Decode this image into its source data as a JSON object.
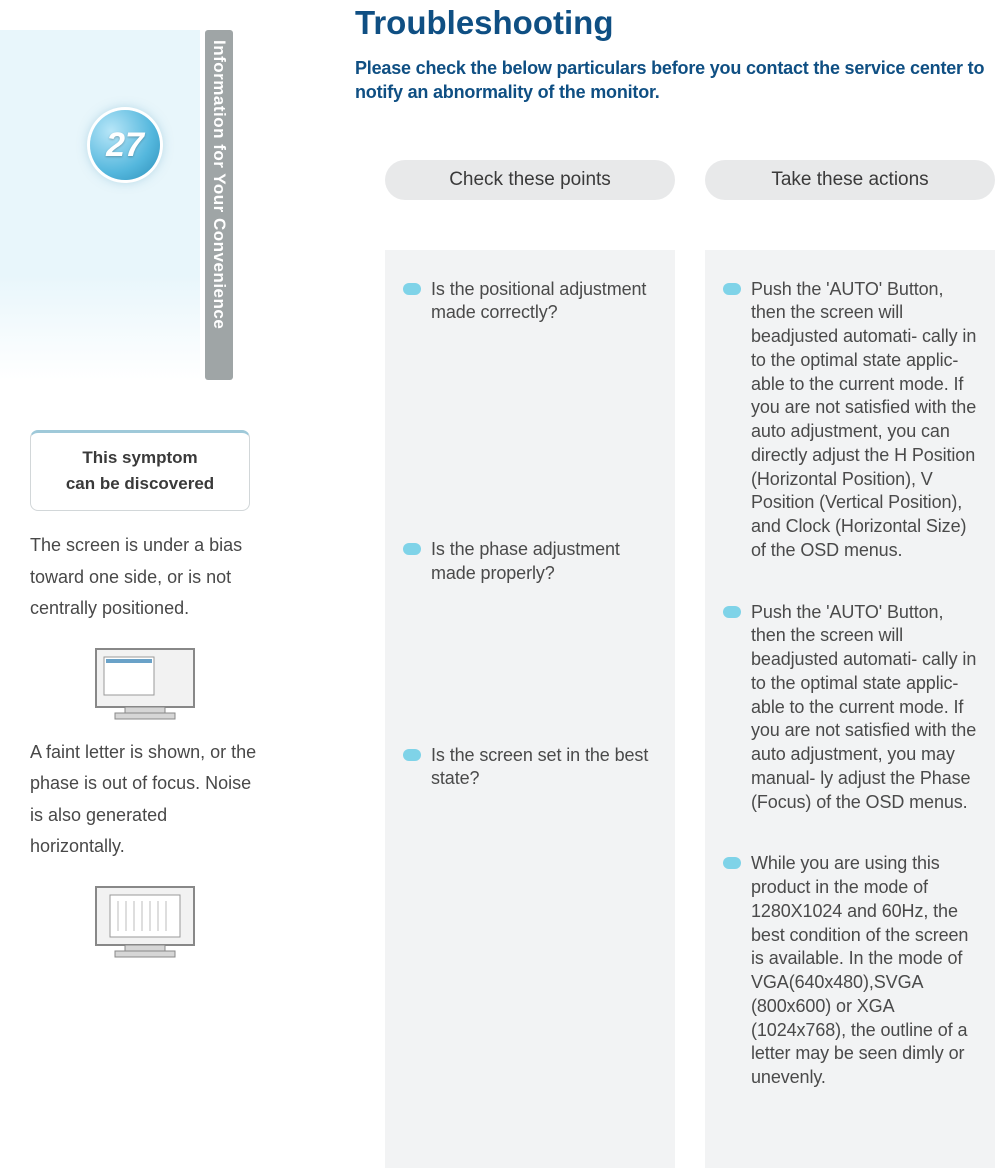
{
  "sidebar": {
    "tab_label": "Information for Your Convenience",
    "page_number": "27",
    "symptom_box_line1": "This symptom",
    "symptom_box_line2": "can be discovered",
    "symptom1": "The screen is under a bias toward one side, or is not centrally positioned.",
    "symptom2": "A faint letter is  shown, or the phase  is out of  focus.  Noise is also  generated horizontally."
  },
  "main": {
    "title": "Troubleshooting",
    "intro": "Please check  the below  particulars before   you contact the  service center to notify an abnormality of the monitor.",
    "col_headers": {
      "check": "Check these points",
      "action": "Take these actions"
    },
    "checks": {
      "c1": "Is the positional adjustment made correctly?",
      "c2": "Is the phase adjustment made properly?",
      "c3": "Is the screen set in the best state?"
    },
    "actions": {
      "a1": " Push  the 'AUTO' Button, then the screen  will beadjusted  automati- cally in to the  optimal state applic- able to the current mode.\nIf  you are  not satisfied   with the auto adjustment,  you can  directly adjust the H Position (Horizontal Position),  V Position (Vertical Position),  and Clock (Horizontal Size) of the OSD menus.",
      "a2": "Push  the 'AUTO' Button, then the screen  will beadjusted  automati- cally in to the  optimal state applic- able to the current mode.\n If you   are not satisfied  with  the auto adjustment, you may manual- ly adjust the Phase (Focus) of the OSD menus.",
      "a3": "While you are using  this product in   the mode of  1280X1024 and 60Hz,  the  best condition  of   the screen  is   available.  In the\nmode  of  VGA(640x480),SVGA (800x600) or  XGA (1024x768),\n the outline of a letter may be seen dimly or unevenly."
    }
  }
}
